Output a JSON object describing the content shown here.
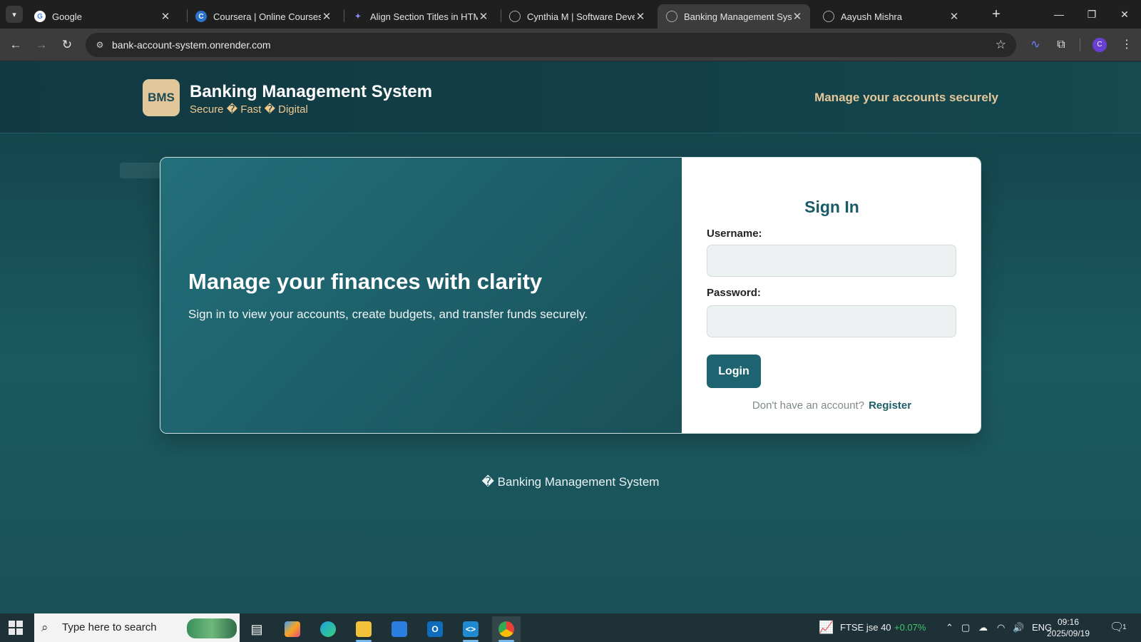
{
  "browser": {
    "tabs": [
      {
        "title": "Google",
        "icon": "google-icon",
        "active": false
      },
      {
        "title": "Coursera | Online Courses Fr",
        "icon": "coursera-icon",
        "active": false
      },
      {
        "title": "Align Section Titles in HTML",
        "icon": "ai-chat-icon",
        "active": false
      },
      {
        "title": "Cynthia M | Software Develo",
        "icon": "globe-icon",
        "active": false
      },
      {
        "title": "Banking Management Syster",
        "icon": "globe-icon",
        "active": true
      },
      {
        "title": "Aayush Mishra",
        "icon": "globe-icon",
        "active": false
      }
    ],
    "url": "bank-account-system.onrender.com",
    "profile_initial": "C"
  },
  "site": {
    "logo_text": "BMS",
    "brand_name": "Banking Management System",
    "brand_tagline": "Secure � Fast � Digital",
    "header_tagline": "Manage your accounts securely",
    "hero_title": "Manage your finances with clarity",
    "hero_subtitle": "Sign in to view your accounts, create budgets, and transfer funds securely.",
    "form": {
      "heading": "Sign In",
      "username_label": "Username:",
      "username_value": "",
      "password_label": "Password:",
      "password_value": "",
      "login_label": "Login",
      "no_account_text": "Don't have an account?",
      "register_label": "Register"
    },
    "footer": "� Banking Management System"
  },
  "taskbar": {
    "search_placeholder": "Type here to search",
    "ticker_name": "FTSE jse 40",
    "ticker_change": "+0.07%",
    "language": "ENG",
    "time": "09:16",
    "date": "2025/09/19",
    "notification_count": "1"
  },
  "colors": {
    "page_bg": "#1b5a61",
    "accent": "#1d6470",
    "logo_bg": "#e2c79a",
    "tagline": "#e6c79a"
  }
}
